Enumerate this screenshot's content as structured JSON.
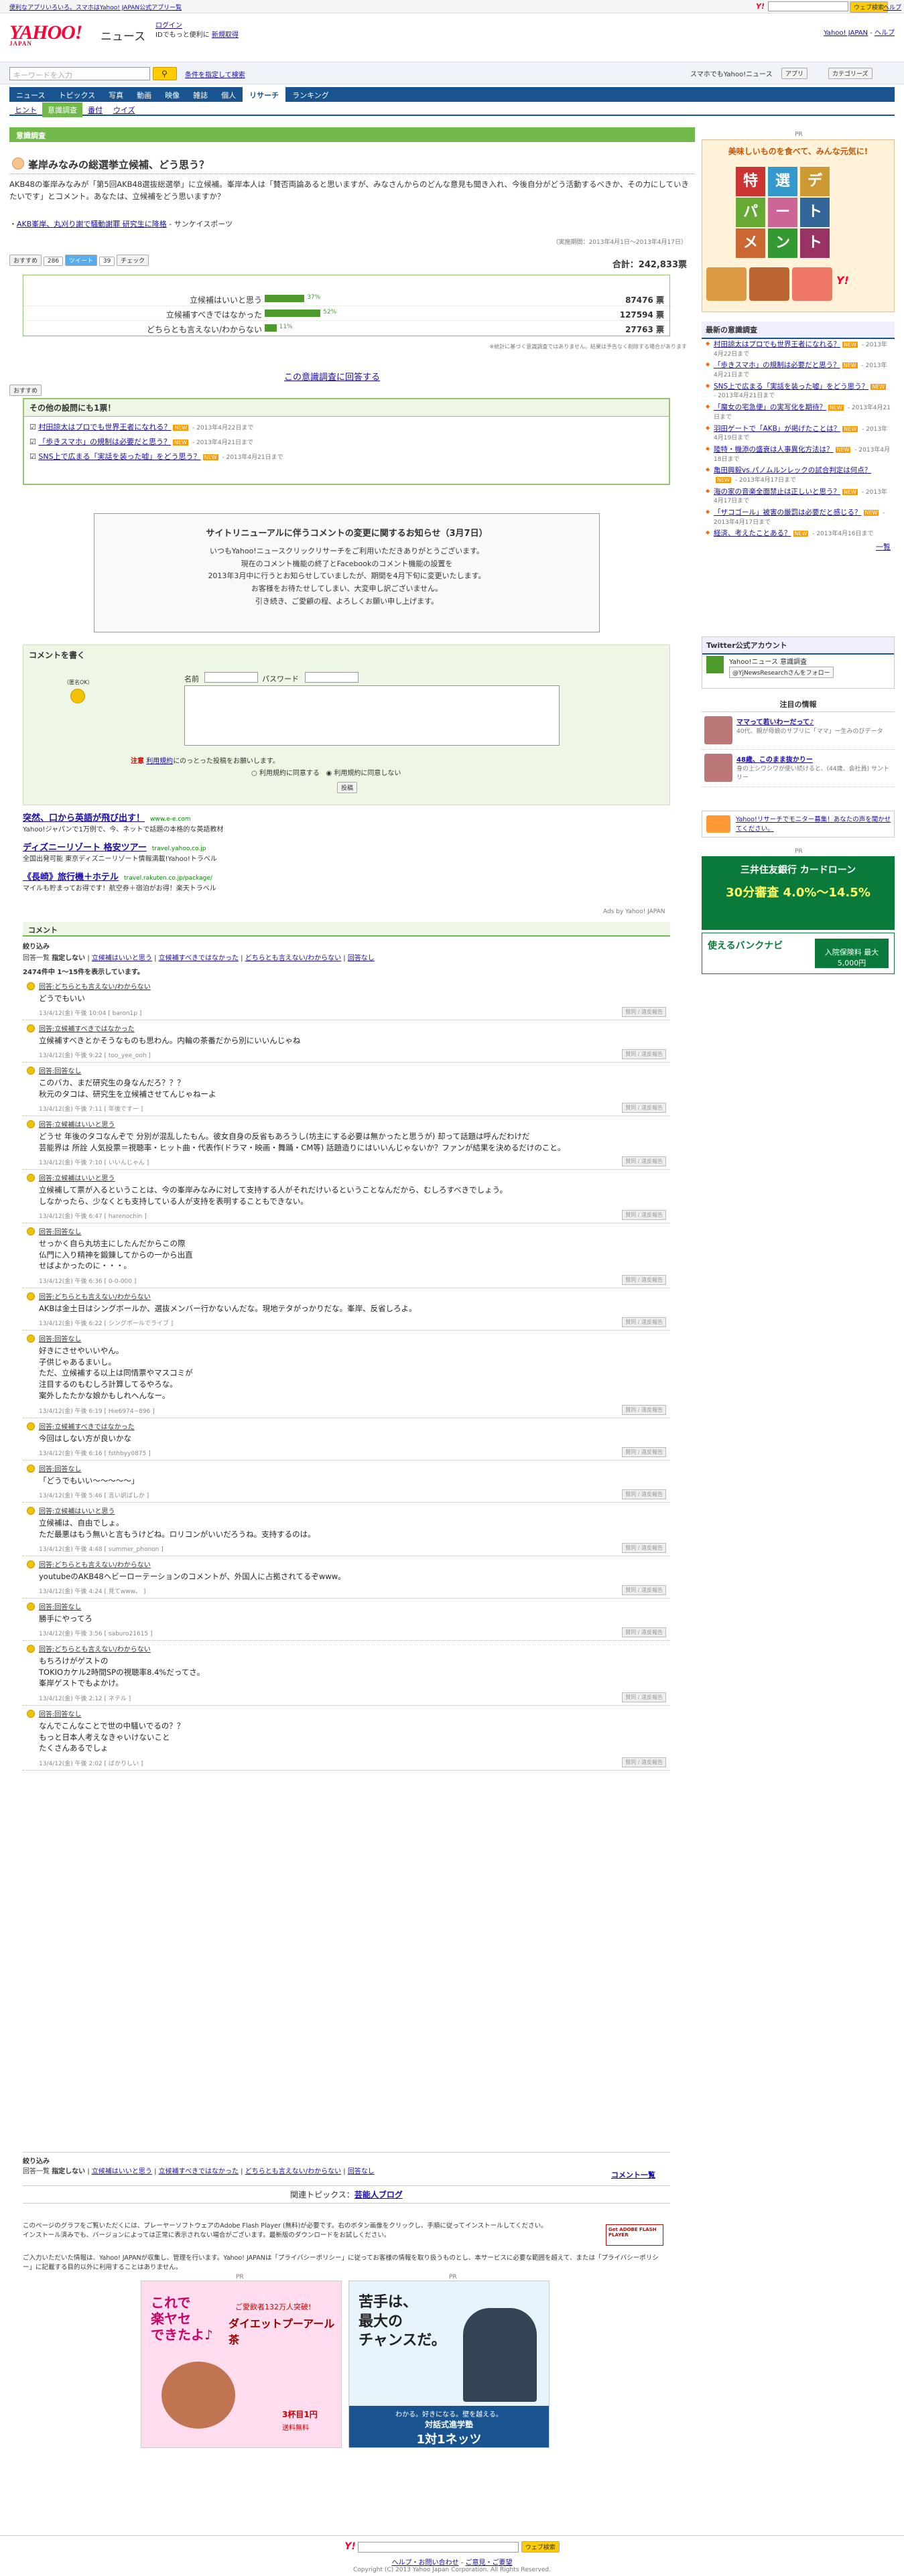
{
  "topbar": {
    "left_text": "便利なアプリいろいろ。スマホはYahoo! JAPAN公式アプリー覧",
    "right_search_btn": "ウェブ検索",
    "right_help": "ヘルプ"
  },
  "header": {
    "logo": "YAHOO!",
    "logo_sub": "JAPAN",
    "service": "ニュース",
    "login": "ログイン",
    "login_note": "IDでもっと便利に",
    "register": "新規取得",
    "top_links": [
      "Yahoo! JAPAN",
      "ヘルプ"
    ]
  },
  "search": {
    "placeholder": "キーワードを入力",
    "btn": "",
    "conditions": "条件を指定して検索",
    "right_items": [
      "スマホでもYahoo!ニュース",
      "アプリ",
      "カテゴリーズ"
    ]
  },
  "nav": {
    "tabs": [
      "ニュース",
      "トピックス",
      "写真",
      "動画",
      "映像",
      "雑誌",
      "個人",
      "リサーチ",
      "ランキング"
    ],
    "active": "リサーチ"
  },
  "subnav": [
    "ヒント",
    "意識調査",
    "番付",
    "ウイズ"
  ],
  "section_tag": "意識調査",
  "question": {
    "title": "峯岸みなみの総選挙立候補、どう思う？",
    "body": "AKB48の峯岸みなみが「第5回AKB48選抜総選挙」に立候補。峯岸本人は「賛否両論あると思いますが、みなさんからのどんな意見も聞き入れ、今後自分がどう活動するべきか、その力にしていきたいです」とコメント。あなたは、立候補をどう思いますか？",
    "related": "AKB峯岸、丸刈り謝で騒動謝罪 研究生に降格",
    "related_source": " - サンケイスポーツ",
    "period": "（実施期間：2013年4月1日～2013年4月17日）",
    "share": [
      "おすすめ",
      "ツイート",
      "チェック"
    ],
    "share_counts": [
      "286",
      "39"
    ],
    "total_label": "合計：242,833票",
    "results": [
      {
        "label": "立候補はいいと思う",
        "pct": "37%",
        "pct_value": 37,
        "votes": "87476 票"
      },
      {
        "label": "立候補すべきではなかった",
        "pct": "52%",
        "pct_value": 52,
        "votes": "127594 票"
      },
      {
        "label": "どちらとも言えない/わからない",
        "pct": "11%",
        "pct_value": 11,
        "votes": "27763 票"
      }
    ],
    "note": "※統計に基づく意識調査ではありません。結果は予告なく削除する場合があります",
    "answer_link": "この意識調査に回答する"
  },
  "other_questions": {
    "title": "その他の設問にも1票！",
    "items": [
      {
        "text": "村田諒太はプロでも世界王者になれる？",
        "date": " - 2013年4月22日まで"
      },
      {
        "text": "「歩きスマホ」の規制は必要だと思う？",
        "date": " - 2013年4月21日まで"
      },
      {
        "text": "SNS上で広まる「実話を装った嘘」をどう思う？",
        "date": " - 2013年4月21日まで"
      }
    ],
    "new_badge": "NEW"
  },
  "notice": {
    "title": "サイトリニューアルに伴うコメントの変更に関するお知らせ（3月7日）",
    "lines": [
      "いつもYahoo!ニュースクリックリサーチをご利用いただきありがとうございます。",
      "現在のコメント機能の終了とFacebookのコメント機能の設置を",
      "2013年3月中に行うとお知らせしていましたが、期間を4月下旬に変更いたします。",
      "お客様をお待たせしてしまい、大変申し訳ございません。",
      "引き続き、ご愛顧の程、よろしくお願い申し上げます。"
    ]
  },
  "comment_form": {
    "title": "コメントを書く",
    "anon": "（匿名OK）",
    "name_label": "名前",
    "pass_label": "パスワード",
    "notice_prefix": "注意",
    "notice_link": "利用規約",
    "notice_text": "にのっとった投稿をお願いします。",
    "radio1": "利用規約に同意する",
    "radio2": "利用規約に同意しない",
    "submit": "投稿"
  },
  "text_ads": [
    {
      "title": "突然、口から英語が飛び出す！",
      "url": "www.e-e.com",
      "desc": "Yahoo!ジャパンで1万例で、今、ネットで話題の本格的な英語教材"
    },
    {
      "title": "ディズニーリゾート 格安ツアー",
      "url": "travel.yahoo.co.jp",
      "desc": "全国出発可能 東京ディズニーリゾート情報満載!Yahoo!トラベル"
    },
    {
      "title": "《長崎》旅行機＋ホテル",
      "url": "travel.rakuten.co.jp/package/",
      "desc": "マイルも貯まってお得です！航空券＋宿泊がお得！楽天トラベル"
    }
  ],
  "ads_by": "Ads by Yahoo! JAPAN",
  "comments_section": {
    "title": "コメント",
    "filter_title": "絞り込み",
    "filters": [
      "回答一覧",
      "指定しない",
      "立候補はいいと思う",
      "立候補すべきではなかった",
      "どちらとも言えない/わからない",
      "回答なし"
    ],
    "count_text": "2474件中 1～15件を表示しています。",
    "btn_labels": [
      "賛同 / 違反報告"
    ],
    "items": [
      {
        "meta": "回答:どちらとも言えない/わからない",
        "text": "どうでもいい",
        "date": "13/4/12(金) 午後 10:04 [ baron1p ]"
      },
      {
        "meta": "回答:立候補すべきではなかった",
        "text": "立候補すべきとかそうなものも思わん。内輪の茶番だから別にいいんじゃね",
        "date": "13/4/12(金) 午後 9:22 [ too_yee_ooh ]"
      },
      {
        "meta": "回答:回答なし",
        "text": "このバカ、まだ研究生の身なんだろ？？？\n秋元のタコは、研究生を立候補させてんじゃねーよ",
        "date": "13/4/12(金) 午後 7:11 [ 年後ですー ]"
      },
      {
        "meta": "回答:立候補はいいと思う",
        "text": "どうせ 年後のタコなんぞで 分別が混乱したもん。彼女自身の反省もあろうし(坊主にする必要は無かったと思うが) 却って話題は呼んだわけだ\n芸能界は 所詮 人気投票＝視聴率・ヒット曲・代表作(ドラマ・映画・舞踊・CM等) 話題造りにはいいんじゃないか？ファンが結果を決めるだけのこと。",
        "date": "13/4/12(金) 午後 7:10 [ いいんじゃん ]"
      },
      {
        "meta": "回答:立候補はいいと思う",
        "text": "立候補して票が入るということは、今の峯岸みなみに対して支持する人がそれだけいるということなんだから、むしろすべきでしょう。\nしなかったら、少なくとも支持している人が支持を表明することもできない。",
        "date": "13/4/12(金) 午後 6:47 [ harenochin ]"
      },
      {
        "meta": "回答:回答なし",
        "text": "せっかく自ら丸坊主にしたんだからこの際\n仏門に入り精神を鍛錬してからの一から出直\nせばよかったのに・・・。",
        "date": "13/4/12(金) 午後 6:36 [ 0-0-000 ]"
      },
      {
        "meta": "回答:どちらとも言えない/わからない",
        "text": "AKBは金土日はシングボールか、選抜メンバー行かないんだな。現地テタがっかりだな。峯岸、反省しろよ。",
        "date": "13/4/12(金) 午後 6:22 [ シングボールでライブ ]"
      },
      {
        "meta": "回答:回答なし",
        "text": "好きにさせやいいやん。\n子供じゃあるまいし。\nただ、立候補する以上は同情票やマスコミが\n注目するのもむしろ計算してるやろな。\n案外したたかな娘かもしれへんなー。",
        "date": "13/4/12(金) 午後 6:19 [ Hie6974~896 ]"
      },
      {
        "meta": "回答:立候補すべきではなかった",
        "text": "今回はしない方が良いかな",
        "date": "13/4/12(金) 午後 6:16 [ fsthbyy0875 ]"
      },
      {
        "meta": "回答:回答なし",
        "text": "「どうでもいい～～～～～」",
        "date": "13/4/12(金) 午後 5:46 [ 言い訳ばしか ]"
      },
      {
        "meta": "回答:立候補はいいと思う",
        "text": "立候補は、自由でしょ。\nただ最悪はもう無いと言もうけどね。ロリコンがいいだろうね。支持するのは。",
        "date": "13/4/12(金) 午後 4:48 [ summer_phonon ]"
      },
      {
        "meta": "回答:どちらとも言えない/わからない",
        "text": "youtubeのAKB48ヘビーローテーションのコメントが、外国人に占拠されてるぞwww。",
        "date": "13/4/12(金) 午後 4:24 [ 見てwww。 ]"
      },
      {
        "meta": "回答:回答なし",
        "text": "勝手にやってろ",
        "date": "13/4/12(金) 午後 3:56 [ saburo21615 ]"
      },
      {
        "meta": "回答:どちらとも言えない/わからない",
        "text": "もちろけがゲストの\nTOKIOカケル2時間SPの視聴率8.4%だってさ。\n峯岸ゲストでもよかけ。",
        "date": "13/4/12(金) 午後 2:12 [ ネテル ]"
      },
      {
        "meta": "回答:回答なし",
        "text": "なんでこんなことで世の中騒いでるの？？\nもっと日本人考えなきゃいけないこと\nたくさんあるでしょ",
        "date": "13/4/12(金) 午後 2:02 [ ばかりしい ]"
      }
    ],
    "bottom_link": "コメント一覧"
  },
  "related_topics": {
    "label": "関連トピックス：",
    "link": "芸能人ブログ"
  },
  "flash_note": {
    "text1": "このページのグラフをご覧いただくには、プレーヤーソフトウェアのAdobe Flash Player (無料)が必要です。右のボタン画像をクリックし、手順に従ってインストールしてください。",
    "text2": "インストール済みでも、バージョンによっては正常に表示されない場合がございます。最新版のダウンロードをお試しください。",
    "badge": "Get ADOBE FLASH PLAYER",
    "privacy": "ご入力いただいた情報は、Yahoo! JAPANが収集し、管理を行います。Yahoo! JAPANは「プライバシーポリシー」に従ってお客様の情報を取り扱うものとし、本サービスに必要な範囲を超えて、または「プライバシーポリシー」に記載する目的以外に利用することはありません。"
  },
  "bottom_ads": [
    {
      "lines": [
        "これで",
        "楽ヤセ",
        "できたよ♪",
        "ご愛飲者132万人突破!",
        "ダイエットプーアール茶",
        "3杯目1円",
        "送料無料"
      ]
    },
    {
      "lines": [
        "苦手は、",
        "最大の",
        "チャンスだ。",
        "わかる。好きになる。壁を越える。",
        "対話式進学塾",
        "1対1ネッツ"
      ]
    }
  ],
  "right": {
    "pr_label": "PR",
    "ad1_title": "美味しいものを食べて、みんな元気に!",
    "ad1_lines": [
      "特",
      "選",
      "デ",
      "パ",
      "ー",
      "ト",
      "メ",
      "ン",
      "ト"
    ],
    "latest_title": "最新の意識調査",
    "latest": [
      {
        "text": "村田諒太はプロでも世界王者になれる？",
        "date": " - 2013年4月22日まで"
      },
      {
        "text": "「歩きスマホ」の規制は必要だと思う？",
        "date": " - 2013年4月21日まで"
      },
      {
        "text": "SNS上で広まる「実話を装った嘘」をどう思う？",
        "date": " - 2013年4月21日まで"
      },
      {
        "text": "「魔女の宅急便」の実写化を期待？",
        "date": " - 2013年4月21日まで"
      },
      {
        "text": "羽田ゲートで「AKB」が掲げたことは？",
        "date": " - 2013年4月19日まで"
      },
      {
        "text": "陸特・機添の盛衰は人事異化方法は？",
        "date": " - 2013年4月18日まで"
      },
      {
        "text": "亀田興毅vs.パノムルンレックの試合判定は何点？",
        "date": " - 2013年4月17日まで"
      },
      {
        "text": "海の家の音楽全面禁止は正しいと思う？",
        "date": " - 2013年4月17日まで"
      },
      {
        "text": "「ザコゴール」被害の厳罰は必要だと感じる？",
        "date": " - 2013年4月17日まで"
      },
      {
        "text": "経済、考えたことある？",
        "date": " - 2013年4月16日まで"
      }
    ],
    "more": "一覧",
    "twitter_title": "Twitter公式アカウント",
    "twitter_name": "Yahoo!ニュース 意識調査",
    "twitter_handle": "@YjNewsResearchさんをフォロー",
    "notice_title": "注目の情報",
    "notice_items": [
      {
        "text": "ママって若いわーだって♪",
        "sub": "40代、親が母娘のサプリに「ママ」ー生みのびデータ"
      },
      {
        "text": "48歳、このまま抜かりー",
        "sub": "身の上シワシワが使い続けると、(44歳、会社員) サントリー"
      }
    ],
    "monitor_text": "Yahoo!リサーチでモニター募集！あなたの声を聞かせてください。",
    "pr2_label": "PR",
    "card_title": "三井住友銀行 カードローン",
    "card_rates": [
      "30分審査",
      "4.0%～14.5%"
    ],
    "bank_title": "使えるバンクナビ",
    "bank_sub": "入院保険料 最大5,000円"
  },
  "footer": {
    "search_btn": "ウェブ検索",
    "links": [
      "ヘルプ・お問い合わせ",
      "ご意見・ご要望"
    ],
    "copyright": "Copyright (C) 2013 Yahoo Japan Corporation. All Rights Reserved."
  }
}
